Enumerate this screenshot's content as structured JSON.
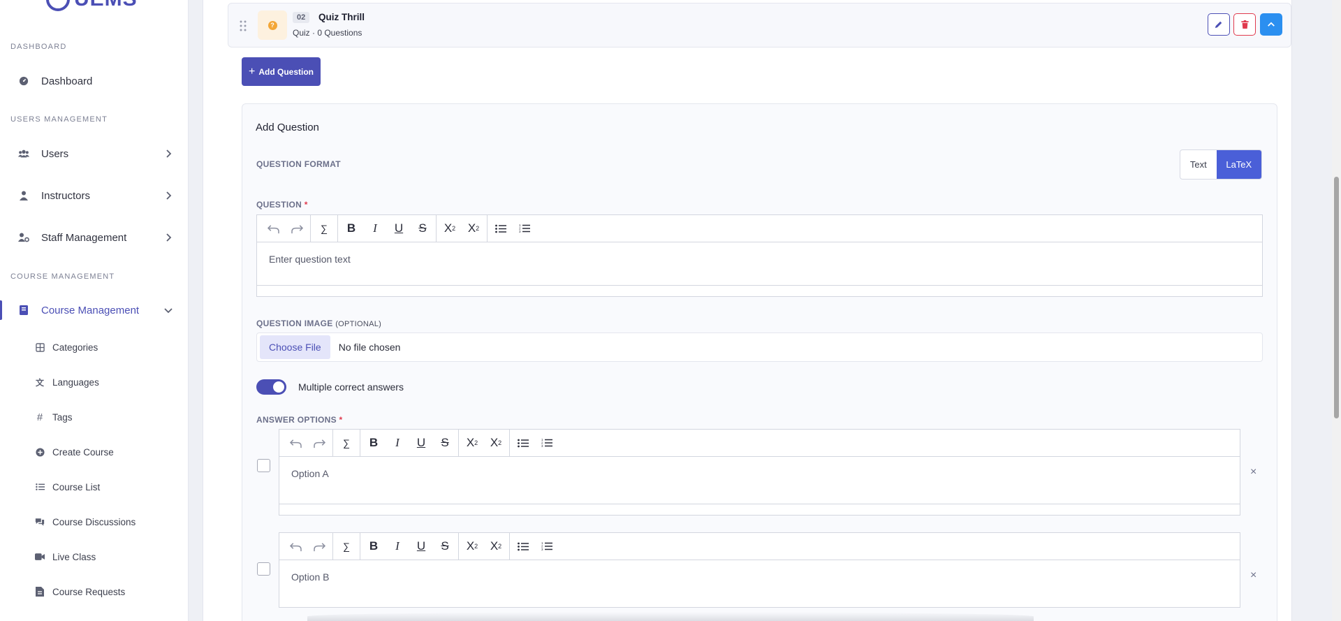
{
  "brand": {
    "name": "UEMS"
  },
  "sidebar": {
    "sections": [
      "DASHBOARD",
      "USERS MANAGEMENT",
      "COURSE MANAGEMENT"
    ],
    "items": [
      {
        "label": "Dashboard"
      },
      {
        "label": "Users"
      },
      {
        "label": "Instructors"
      },
      {
        "label": "Staff Management"
      },
      {
        "label": "Course Management"
      }
    ],
    "sub_items": [
      {
        "label": "Categories"
      },
      {
        "label": "Languages"
      },
      {
        "label": "Tags"
      },
      {
        "label": "Create Course"
      },
      {
        "label": "Course List"
      },
      {
        "label": "Course Discussions"
      },
      {
        "label": "Live Class"
      },
      {
        "label": "Course Requests"
      }
    ]
  },
  "lesson": {
    "number": "02",
    "title": "Quiz Thrill",
    "subtitle": "Quiz · 0 Questions"
  },
  "add_question_btn": "Add Question",
  "form": {
    "title": "Add Question",
    "format_label": "QUESTION FORMAT",
    "format_options": [
      "Text",
      "LaTeX"
    ],
    "format_selected": "LaTeX",
    "question_label": "QUESTION",
    "required_mark": "*",
    "question_placeholder": "Enter question text",
    "image_label": "QUESTION IMAGE",
    "image_optional": "(OPTIONAL)",
    "choose_file": "Choose File",
    "no_file": "No file chosen",
    "multiple_label": "Multiple correct answers",
    "answer_label": "ANSWER OPTIONS",
    "options": [
      {
        "placeholder": "Option A"
      },
      {
        "placeholder": "Option B"
      }
    ],
    "remove_glyph": "×"
  },
  "toolbar": {
    "sigma": "∑"
  },
  "colors": {
    "accent": "#4b4fb5",
    "latex_active": "#4a5fd8",
    "danger": "#e03a4e",
    "info": "#2b8ff0"
  }
}
